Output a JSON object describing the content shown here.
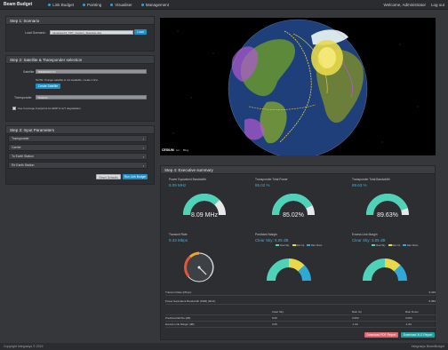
{
  "header": {
    "brand": "Beam Budget",
    "nav": [
      "Link Budget",
      "Pointing",
      "Visualiser",
      "Management"
    ],
    "welcome": "Welcome, Administrator",
    "logout": "Log out"
  },
  "step1": {
    "title": "Step 1: Scenario",
    "load_label": "Load Scenario:",
    "file_value": "Inmarsat-F4_TRY_Custom_Scenario.xlsx",
    "load_button": "Load"
  },
  "step2": {
    "title": "Step 2: Satellite & Transponder selection",
    "satellite_label": "Satellite",
    "satellite_value": "INMARSAT F4",
    "note": "NOTE: If target satellite is not available, create it first.",
    "create_button": "Create Satellite",
    "transponder_label": "Transponder",
    "transponder_value": "Custom",
    "checkbox_label": "Use Coverage Footprints for EIRP & G/T degradation"
  },
  "step3": {
    "title": "Step 3: Input Parameters",
    "items": [
      "Transponder",
      "Carrier",
      "To Earth Station",
      "Rx Earth Station"
    ],
    "reset_button": "Reset Defaults",
    "run_button": "Run Link Budget"
  },
  "map": {
    "credit": "CESIUM",
    "credit_sub": "ion",
    "bing": "Bing"
  },
  "step4": {
    "title": "Step 4: Executive summary",
    "kpis": [
      {
        "title": "Power Equivalent Bandwidth",
        "value": "8.09 MHz",
        "gauge": "8.09 MHz",
        "fraction": 0.75
      },
      {
        "title": "Transponder Total Power",
        "value": "85.02 %",
        "gauge": "85.02%",
        "fraction": 0.85
      },
      {
        "title": "Transponder Total Bandwidth",
        "value": "89.63 %",
        "gauge": "89.63%",
        "fraction": 0.8963
      }
    ],
    "throughput": {
      "title": "Transmit Rate",
      "value": "9.33 Mbps"
    },
    "prediction1": {
      "title": "Predicted Margin",
      "value": "Clear Sky: 8.05 dB",
      "legend": [
        "Clear Sky",
        "Rain Up",
        "Rain Down"
      ]
    },
    "prediction2": {
      "title": "Excess Link Margin",
      "value": "Clear Sky: 3.05 dB",
      "legend": [
        "Clear Sky",
        "Rain Up",
        "Rain Down"
      ]
    },
    "table": {
      "row1_label": "Transmit Rate (Mbps):",
      "row1_value": "9.329",
      "row2_label": "Power Equivalent Bandwidth (PEB) (MHz):",
      "row2_value": "8.089",
      "col_headers": [
        "Clear Sky",
        "Rain Up",
        "Rain Down"
      ],
      "rows": [
        {
          "label": "Predicted Eb/No (dB)",
          "v": [
            "8.05",
            "3.053",
            "3.053"
          ]
        },
        {
          "label": "Excess Link Margin (dB)",
          "v": [
            "3.05",
            "-1.93",
            "-1.93"
          ]
        }
      ]
    },
    "pdf_button": "Download PDF Report",
    "excel_button": "Download XLS Report"
  },
  "footer": {
    "left": "Copyright Integrasys © 2019",
    "right": "Integrasys BeamBudget"
  },
  "colors": {
    "accent": "#1f8fc6",
    "teal": "#4fd3b8",
    "yellow": "#e8d94a",
    "blue": "#2fa8d8"
  }
}
